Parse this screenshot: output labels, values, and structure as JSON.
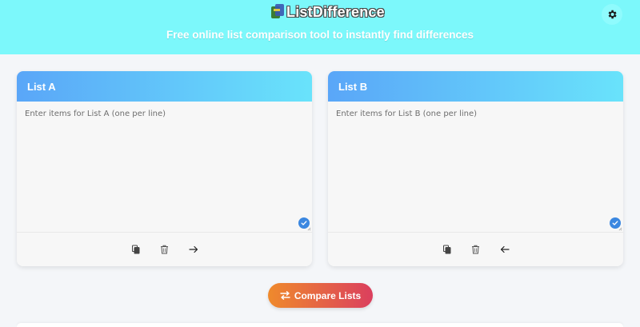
{
  "header": {
    "logo_text": "ListDifference",
    "tagline": "Free online list comparison tool to instantly find differences",
    "bg_color": "#7cf8fb",
    "settings_icon": "gear-icon"
  },
  "list_a": {
    "title": "List A",
    "placeholder": "Enter items for List A (one per line)",
    "value": "",
    "tools": [
      "copy-icon",
      "trash-icon",
      "arrow-right-icon"
    ]
  },
  "list_b": {
    "title": "List B",
    "placeholder": "Enter items for List B (one per line)",
    "value": "",
    "tools": [
      "copy-icon",
      "trash-icon",
      "arrow-left-icon"
    ]
  },
  "compare": {
    "label": "Compare Lists",
    "icon": "swap-arrows-icon",
    "gradient": [
      "#ef8a2c",
      "#db3f5e"
    ]
  },
  "colors": {
    "panel_header_start": "#5aa6f8",
    "panel_header_end": "#69e3fb",
    "check_badge": "#3b87e0"
  }
}
